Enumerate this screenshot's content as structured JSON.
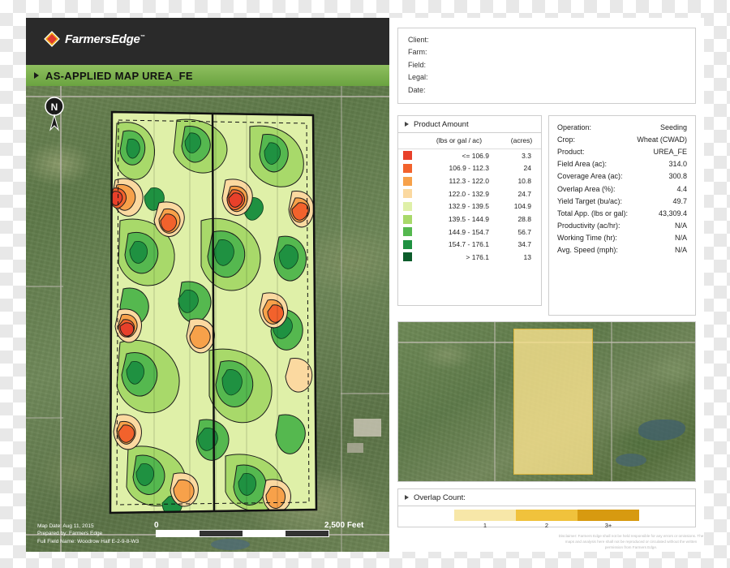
{
  "brand": {
    "name": "FarmersEdge",
    "tm": "™"
  },
  "map": {
    "title": "AS-APPLIED MAP  UREA_FE",
    "compass_label": "N",
    "scale_left": "0",
    "scale_right": "2,500",
    "scale_units": "Feet",
    "footnotes": [
      "Map Date: Aug 11, 2015",
      "Prepared by: Farmers Edge",
      "Full Field Name:  Woodrow Half E-2-9-8-W3"
    ]
  },
  "client": {
    "rows": [
      "Client:",
      "Farm:",
      "Field:",
      "Legal:",
      "Date:"
    ]
  },
  "product_legend": {
    "header": "Product Amount",
    "col_value": "(lbs or gal / ac)",
    "col_acres": "(acres)",
    "rows": [
      {
        "range": "<= 106.9",
        "acres": "3.3",
        "color": "#e8402a"
      },
      {
        "range": "106.9 - 112.3",
        "acres": "24",
        "color": "#f2622c"
      },
      {
        "range": "112.3 - 122.0",
        "acres": "10.8",
        "color": "#f7a14a"
      },
      {
        "range": "122.0 - 132.9",
        "acres": "24.7",
        "color": "#fbd9a0"
      },
      {
        "range": "132.9 - 139.5",
        "acres": "104.9",
        "color": "#dff0a8"
      },
      {
        "range": "139.5 - 144.9",
        "acres": "28.8",
        "color": "#a8d96a"
      },
      {
        "range": "144.9 - 154.7",
        "acres": "56.7",
        "color": "#55b84f"
      },
      {
        "range": "154.7 - 176.1",
        "acres": "34.7",
        "color": "#1f9141"
      },
      {
        "range": "> 176.1",
        "acres": "13",
        "color": "#0c5c2b"
      }
    ]
  },
  "operation": {
    "rows": [
      {
        "key": "Operation:",
        "value": "Seeding"
      },
      {
        "key": "Crop:",
        "value": "Wheat (CWAD)"
      },
      {
        "key": "Product:",
        "value": "UREA_FE"
      },
      {
        "key": "Field Area (ac):",
        "value": "314.0"
      },
      {
        "key": "Coverage Area (ac):",
        "value": "300.8"
      },
      {
        "key": "Overlap Area (%):",
        "value": "4.4"
      },
      {
        "key": "Yield Target (bu/ac):",
        "value": "49.7"
      },
      {
        "key": "Total App. (lbs or gal):",
        "value": "43,309.4"
      },
      {
        "key": "Productivity (ac/hr):",
        "value": "N/A"
      },
      {
        "key": "Working Time (hr):",
        "value": "N/A"
      },
      {
        "key": "Avg. Speed (mph):",
        "value": "N/A"
      }
    ]
  },
  "overlap": {
    "header": "Overlap Count:",
    "ticks": [
      "1",
      "2",
      "3+"
    ],
    "colors": [
      "#f7e7a8",
      "#f0c23c",
      "#d79a10"
    ]
  },
  "disclaimer": "Disclaimer: Farmers Edge shall not be held responsible for any errors or omissions. The maps and analysis here shall not be reproduced or circulated without the written permission from Farmers Edge."
}
